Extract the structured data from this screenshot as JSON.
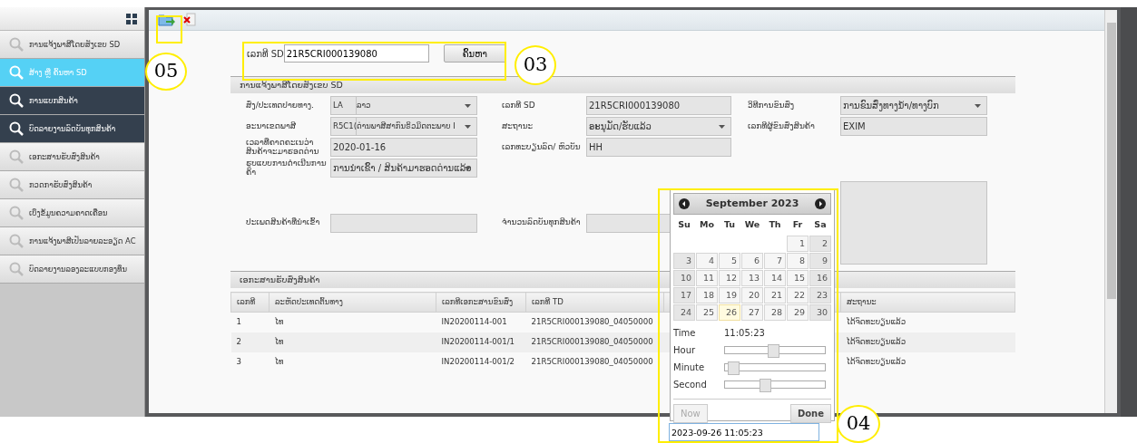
{
  "sidebar": {
    "items": [
      {
        "label": "ການແຈ້ງພາສີໂດຍສັງເຂບ SD",
        "kind": "link",
        "selected": false
      },
      {
        "label": "ສ້າງ ຫຼື ຄົ້ນຫາ SD",
        "kind": "link",
        "selected": true
      },
      {
        "label": "ການແບກສິນຄ້າ",
        "kind": "group",
        "selected": false
      },
      {
        "label": "ບົດລາຍງານລົດບັນທຸກສິນຄ້າ",
        "kind": "group",
        "selected": false
      },
      {
        "label": "ເອກະສານຮັບສົ່ງສິນຄ້າ",
        "kind": "link",
        "selected": false
      },
      {
        "label": "ກວດກາຮັບສົ່ງສິນຄ້າ",
        "kind": "link",
        "selected": false
      },
      {
        "label": "ເບິ່ງຂໍ້ມູນຄວາມຄາດເຄື່ອນ",
        "kind": "link",
        "selected": false
      },
      {
        "label": "ການແຈ້ງພາສີເປັນລາຍລະອຽດ AC",
        "kind": "link",
        "selected": false
      },
      {
        "label": "ບົດລາຍງານລອງລະແບບກອງທຶນ",
        "kind": "link",
        "selected": false
      }
    ]
  },
  "search": {
    "label": "ເລກທີ SD",
    "value": "21R5CRI000139080",
    "button": "ຄົ້ນຫາ"
  },
  "form": {
    "title": "ການແຈ້ງພາສີໂດຍສັງເຂບ SD",
    "fields": [
      {
        "label": "ສົ່ງ/ປະເທດປາຍທາງ.",
        "kind": "coded-select",
        "code": "LA",
        "value": "ລາວ"
      },
      {
        "label": "ເລກທີ SD",
        "kind": "text",
        "value": "21R5CRI000139080"
      },
      {
        "label": "ວິທີການຂົນສົ່ງ",
        "kind": "select",
        "value": "ການຂົນສົ່ງທາງນ້ຳ/ທາງບົກ"
      },
      {
        "label": "ອະນາເຂດພາສີ",
        "kind": "coded-select",
        "code": "R5C1(",
        "value": "ດ່ານພາສີສາກົນຣິວມິດຕະພາບ I"
      },
      {
        "label": "ສະຖານະ",
        "kind": "select",
        "value": "ອະນຸມັດ/ຮັບແລ້ວ"
      },
      {
        "label": "ເລກທີຜູ້ຂົນສົ່ງສິນຄ້າ",
        "kind": "text",
        "value": "EXIM"
      },
      {
        "label": "ເວລາທີ່ຄາດຄະເນວ່າສິນຄ້າຈະມາຮອດດ່ານ",
        "kind": "text",
        "value": "2020-01-16"
      },
      {
        "label": "ເລກທະບຽນລົດ/ ຫົວບັນ",
        "kind": "text",
        "value": "HH"
      },
      {
        "kind": "textarea"
      },
      {
        "label": "ຮູບແບບການດຳເນີນການຄ້າ",
        "kind": "select",
        "value": "ການນຳເຂົ້າ / ສິນຄ້າມາຮອດດ່ານແລ້ວ"
      },
      {
        "label": "ປະເພດສິນຄ້າທີ່ນຳເຂົ້າ",
        "kind": "text"
      },
      {
        "label": "ຈຳນວນລົດບັນທຸກສິນຄ້າ",
        "kind": "text"
      }
    ]
  },
  "table": {
    "title": "ເອກະສານຮັບສົ່ງສິນຄ້າ",
    "columns": [
      "ເລກທີ",
      "ລະຫັດປະເທດຕົ້ນທາງ",
      "ເລກທີເອກະສານຂົນສົ່ງ",
      "ເລກທີ TD",
      "ສະຖານະ"
    ],
    "rows": [
      [
        "1",
        "ໄທ",
        "IN20200114-001",
        "21R5CRI000139080_04050000",
        "ໄດ້ຈົດທະບຽນແລ້ວ"
      ],
      [
        "2",
        "ໄທ",
        "IN20200114-001/1",
        "21R5CRI000139080_04050000",
        "ໄດ້ຈົດທະບຽນແລ້ວ"
      ],
      [
        "3",
        "ໄທ",
        "IN20200114-001/2",
        "21R5CRI000139080_04050000",
        "ໄດ້ຈົດທະບຽນແລ້ວ"
      ]
    ]
  },
  "datepicker": {
    "month": "September 2023",
    "weekdays": [
      "Su",
      "Mo",
      "Tu",
      "We",
      "Th",
      "Fr",
      "Sa"
    ],
    "weeks": [
      [
        {
          "label": "1",
          "selected": false
        },
        {
          "label": "2",
          "selected": false
        }
      ],
      [
        {
          "label": "3",
          "selected": false
        },
        {
          "label": "4",
          "selected": false
        },
        {
          "label": "5",
          "selected": false
        },
        {
          "label": "6",
          "selected": false
        },
        {
          "label": "7",
          "selected": false
        },
        {
          "label": "8",
          "selected": false
        },
        {
          "label": "9",
          "selected": false
        }
      ],
      [
        {
          "label": "10",
          "selected": false
        },
        {
          "label": "11",
          "selected": false
        },
        {
          "label": "12",
          "selected": false
        },
        {
          "label": "13",
          "selected": false
        },
        {
          "label": "14",
          "selected": false
        },
        {
          "label": "15",
          "selected": false
        },
        {
          "label": "16",
          "selected": false
        }
      ],
      [
        {
          "label": "17",
          "selected": false
        },
        {
          "label": "18",
          "selected": false
        },
        {
          "label": "19",
          "selected": false
        },
        {
          "label": "20",
          "selected": false
        },
        {
          "label": "21",
          "selected": false
        },
        {
          "label": "22",
          "selected": false
        },
        {
          "label": "23",
          "selected": false
        }
      ],
      [
        {
          "label": "24",
          "selected": false
        },
        {
          "label": "25",
          "selected": false
        },
        {
          "label": "26",
          "selected": true
        },
        {
          "label": "27",
          "selected": false
        },
        {
          "label": "28",
          "selected": false
        },
        {
          "label": "29",
          "selected": false
        },
        {
          "label": "30",
          "selected": false
        }
      ]
    ],
    "time_label": "Time",
    "time": "11:05:23",
    "sliders": [
      {
        "label": "Hour",
        "level": 0.48
      },
      {
        "label": "Minute",
        "level": 0.08
      },
      {
        "label": "Second",
        "level": 0.4
      }
    ],
    "buttons": [
      {
        "label": "Now",
        "disabled": true
      },
      {
        "label": "Done",
        "disabled": false
      }
    ],
    "input": "2023-09-26 11:05:23"
  },
  "annotations": [
    {
      "label": "05"
    },
    {
      "label": "03"
    },
    {
      "label": "04"
    }
  ]
}
